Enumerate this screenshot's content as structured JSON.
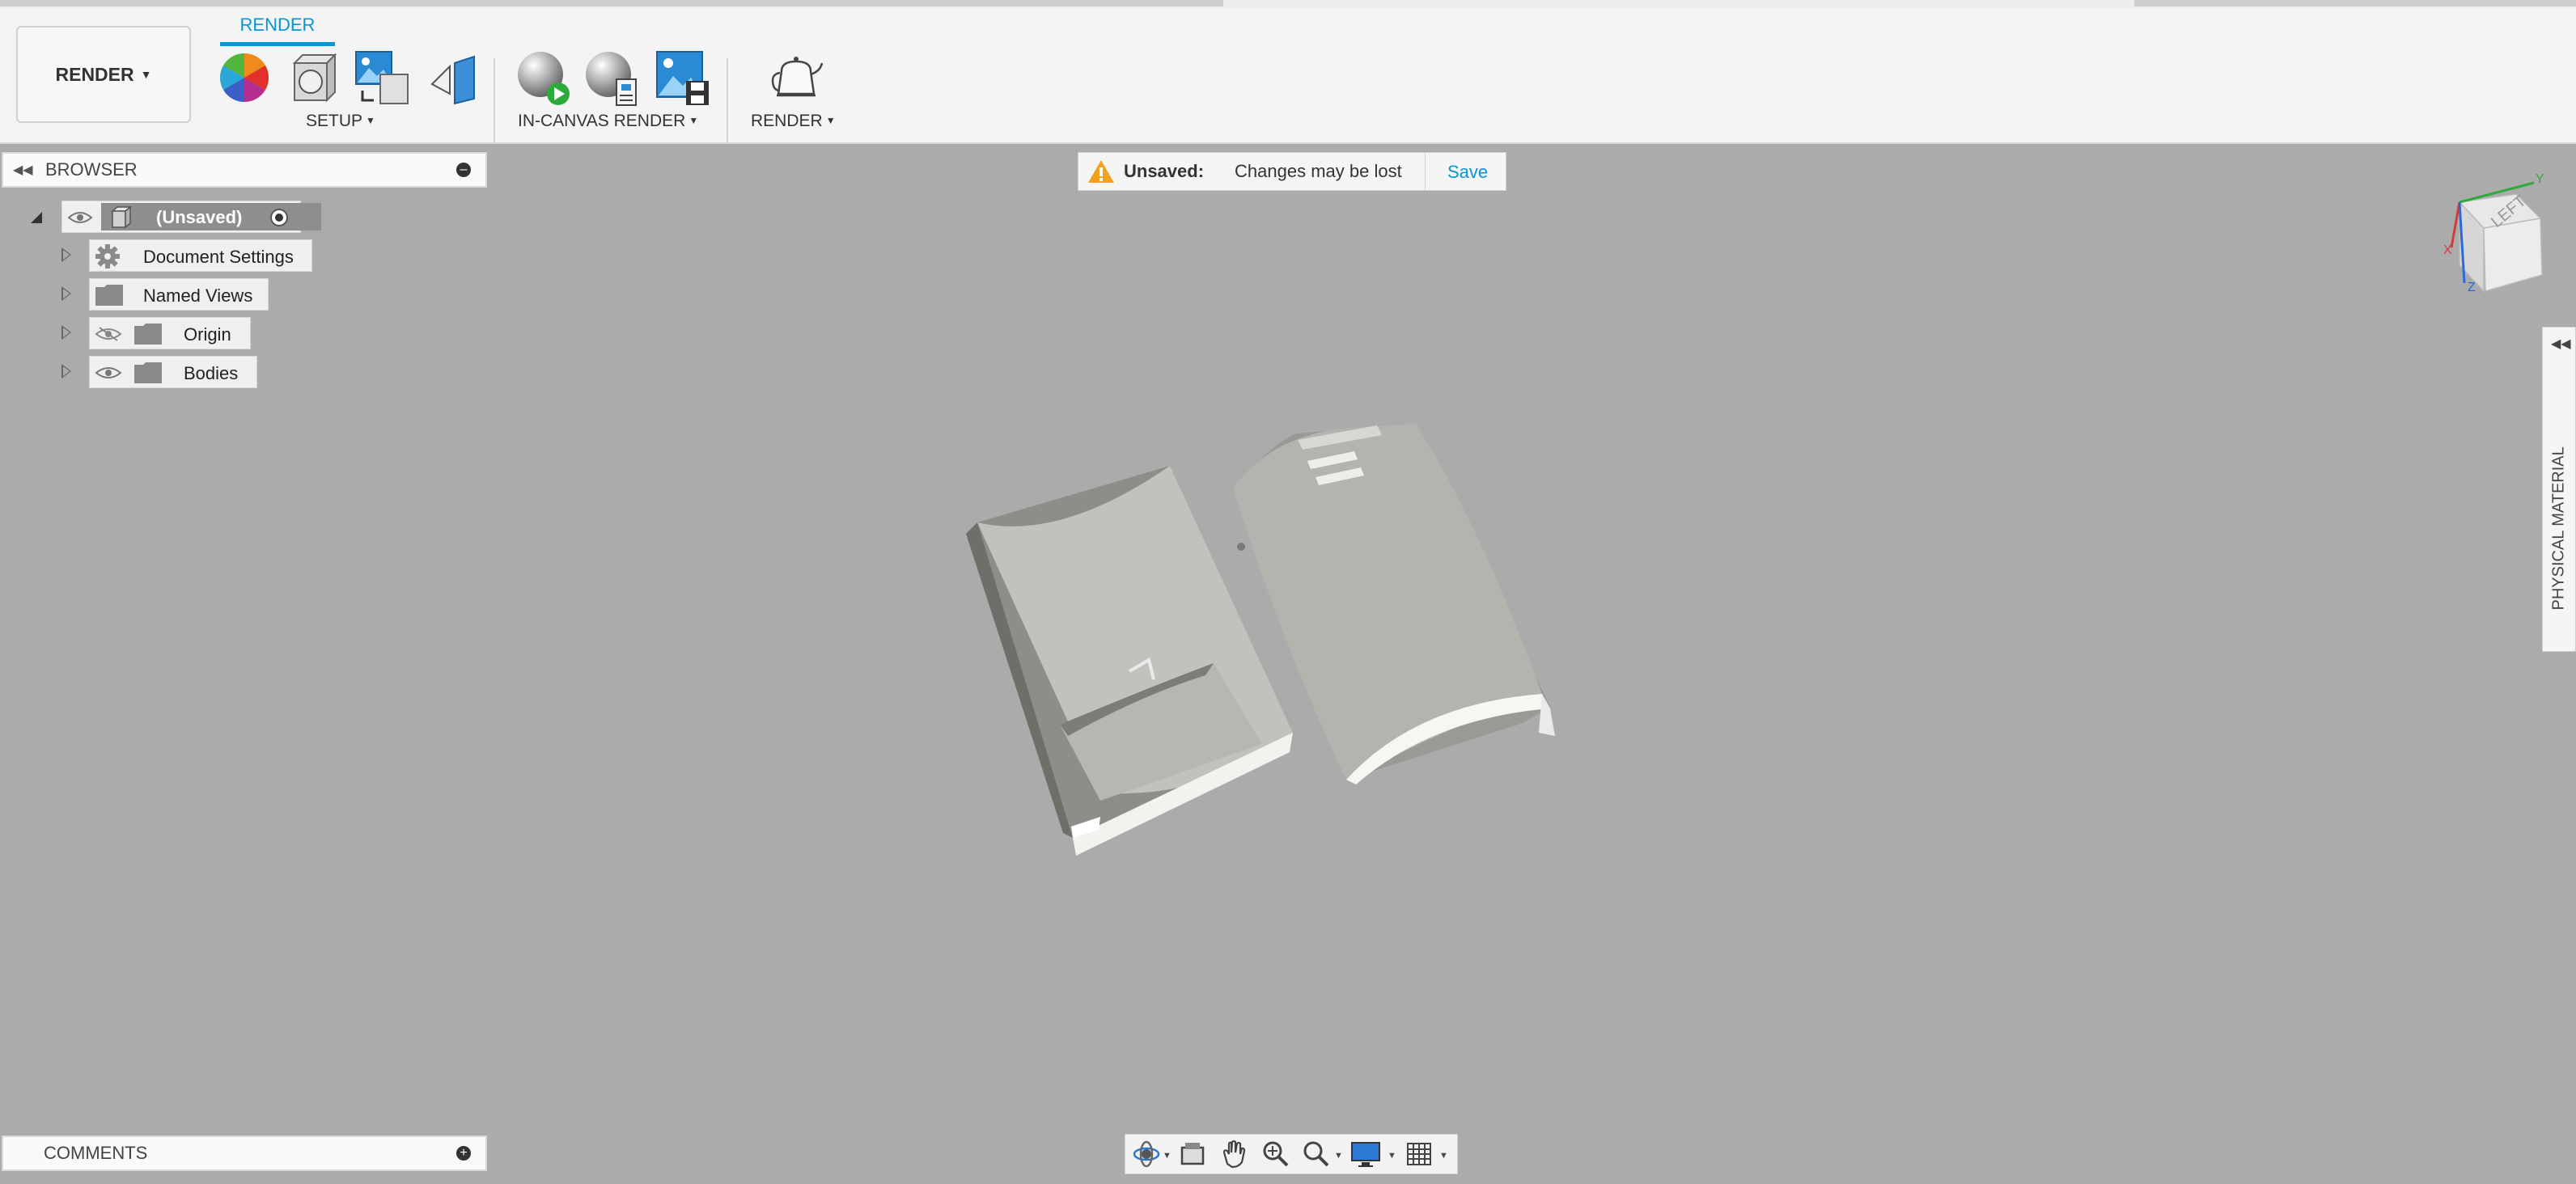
{
  "toolbar": {
    "workspace_label": "RENDER",
    "active_tab": "RENDER",
    "groups": {
      "setup": "SETUP",
      "in_canvas_render": "IN-CANVAS RENDER",
      "render": "RENDER"
    },
    "icons": {
      "appearance": "color-wheel-icon",
      "physical_material": "material-cube-icon",
      "scene_settings": "scene-image-icon",
      "texture_map": "decal-plane-icon",
      "in_canvas_render": "render-sphere-play-icon",
      "in_canvas_settings": "render-sphere-settings-icon",
      "capture_image": "capture-image-icon",
      "render_teapot": "teapot-icon"
    }
  },
  "browser": {
    "title": "BROWSER",
    "root": "(Unsaved)",
    "items": [
      {
        "label": "Document Settings"
      },
      {
        "label": "Named Views"
      },
      {
        "label": "Origin"
      },
      {
        "label": "Bodies"
      }
    ]
  },
  "banner": {
    "status": "Unsaved:",
    "message": "Changes may be lost",
    "action": "Save"
  },
  "right_panel": {
    "label": "PHYSICAL MATERIAL"
  },
  "comments": {
    "title": "COMMENTS"
  },
  "viewcube": {
    "face_label": "LEFT",
    "axes": [
      "X",
      "Y",
      "Z"
    ]
  },
  "colors": {
    "accent": "#0696d7",
    "warning": "#f4a020",
    "canvas": "#ababab"
  }
}
